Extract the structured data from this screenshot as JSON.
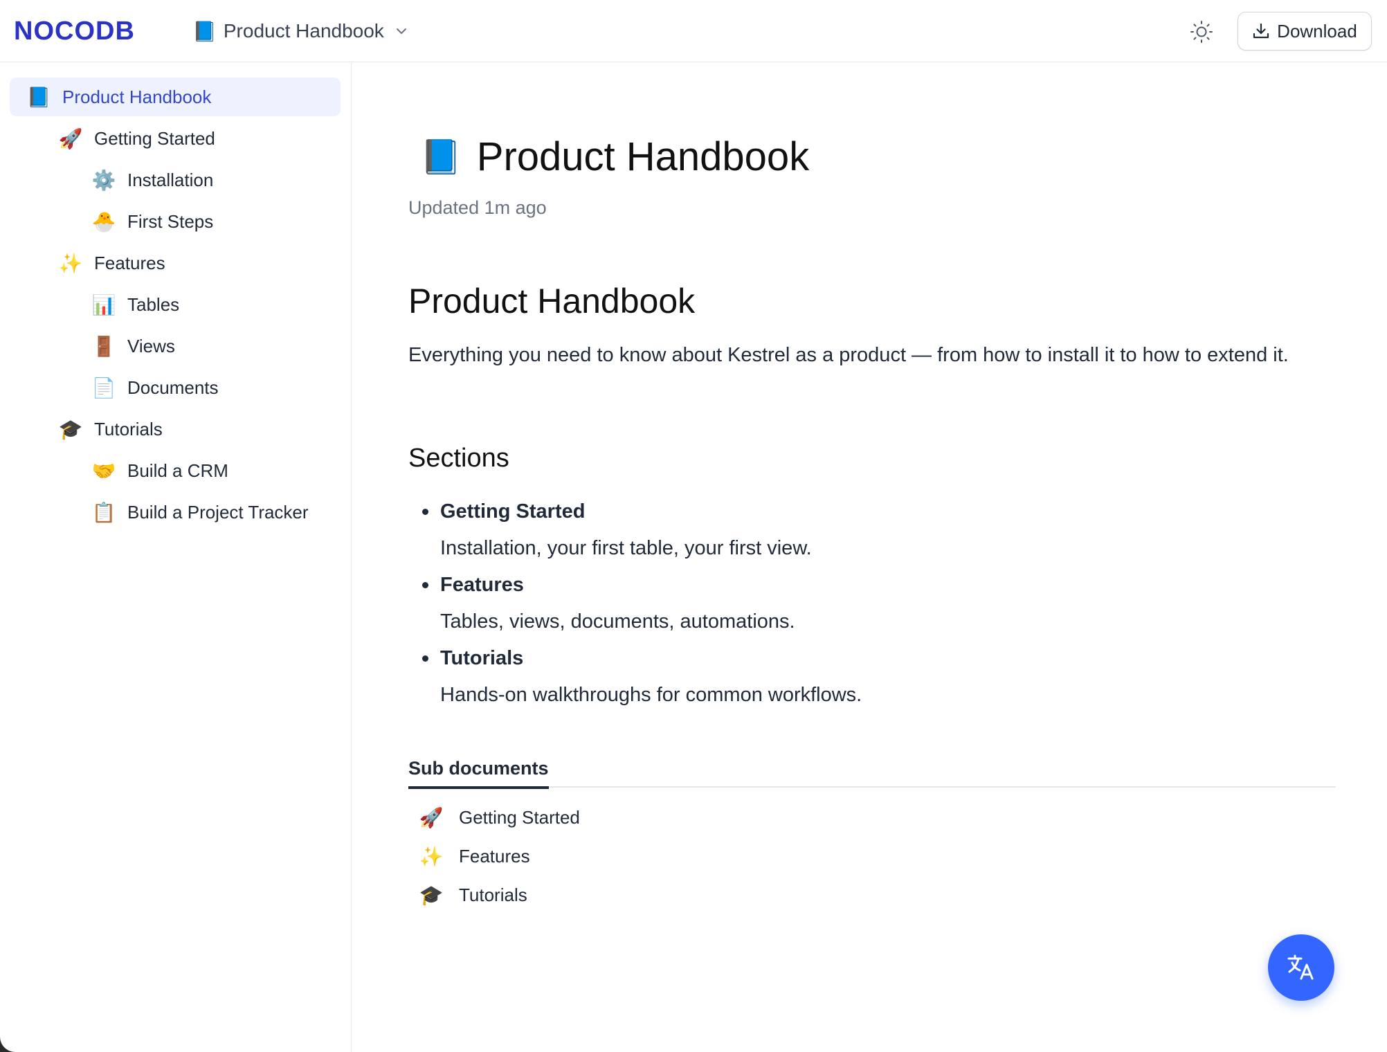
{
  "header": {
    "logo_text": "NOCODB",
    "breadcrumb": {
      "emoji": "📘",
      "label": "Product Handbook"
    },
    "download_label": "Download"
  },
  "sidebar": {
    "items": [
      {
        "emoji": "📘",
        "label": "Product Handbook",
        "level": 0,
        "active": true
      },
      {
        "emoji": "🚀",
        "label": "Getting Started",
        "level": 1
      },
      {
        "emoji": "⚙️",
        "label": "Installation",
        "level": 2
      },
      {
        "emoji": "🐣",
        "label": "First Steps",
        "level": 2
      },
      {
        "emoji": "✨",
        "label": "Features",
        "level": 1
      },
      {
        "emoji": "📊",
        "label": "Tables",
        "level": 2
      },
      {
        "emoji": "🚪",
        "label": "Views",
        "level": 2
      },
      {
        "emoji": "📄",
        "label": "Documents",
        "level": 2
      },
      {
        "emoji": "🎓",
        "label": "Tutorials",
        "level": 1
      },
      {
        "emoji": "🤝",
        "label": "Build a CRM",
        "level": 2
      },
      {
        "emoji": "📋",
        "label": "Build a Project Tracker",
        "level": 2
      }
    ]
  },
  "document": {
    "emoji": "📘",
    "title": "Product Handbook",
    "updated": "Updated 1m ago",
    "heading": "Product Handbook",
    "intro": "Everything you need to know about Kestrel as a product — from how to install it to how to extend it.",
    "sections_heading": "Sections",
    "sections": [
      {
        "title": "Getting Started",
        "desc": "Installation, your first table, your first view."
      },
      {
        "title": "Features",
        "desc": "Tables, views, documents, automations."
      },
      {
        "title": "Tutorials",
        "desc": "Hands-on walkthroughs for common workflows."
      }
    ],
    "sub_documents_tab": "Sub documents",
    "sub_documents": [
      {
        "emoji": "🚀",
        "label": "Getting Started"
      },
      {
        "emoji": "✨",
        "label": "Features"
      },
      {
        "emoji": "🎓",
        "label": "Tutorials"
      }
    ]
  },
  "colors": {
    "brand": "#2b33c5",
    "accent": "#3366ff",
    "active_bg": "#eef2ff",
    "active_text": "#3346c8"
  },
  "icons": {
    "theme_toggle": "sun-icon",
    "download": "download-icon",
    "breadcrumb_dropdown": "chevron-down-icon",
    "fab": "translate-icon"
  }
}
